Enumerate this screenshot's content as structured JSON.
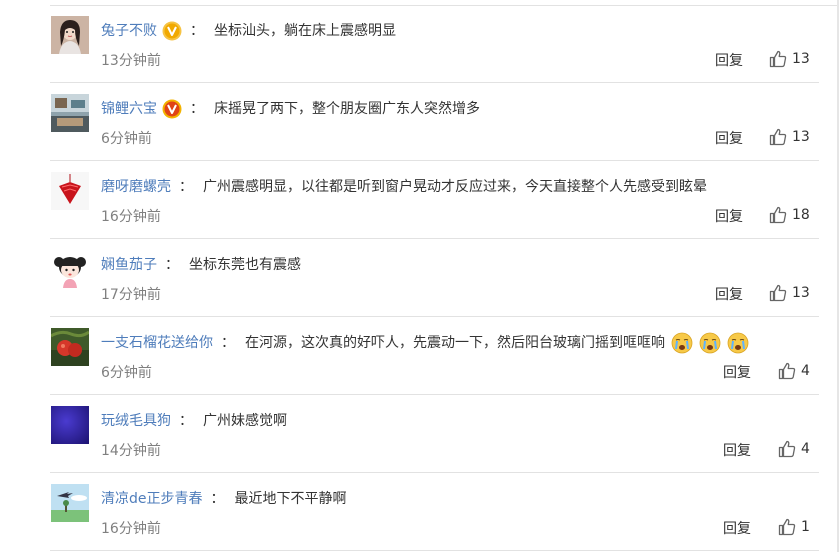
{
  "comments": [
    {
      "user": "兔子不败",
      "verified": true,
      "badge_color": "#f4b400",
      "separator": "：",
      "text": "坐标汕头，躺在床上震感明显",
      "time": "13分钟前",
      "reply_label": "回复",
      "likes": "13",
      "avatar_icon": "avatar-girl-icon"
    },
    {
      "user": "锦鲤六宝",
      "verified": true,
      "badge_color": "#e8a000",
      "separator": "：",
      "text": "床摇晃了两下，整个朋友圈广东人突然增多",
      "time": "6分钟前",
      "reply_label": "回复",
      "likes": "13",
      "avatar_icon": "avatar-room-icon"
    },
    {
      "user": "磨呀磨螺壳",
      "verified": false,
      "separator": "：",
      "text": "广州震感明显，以往都是听到窗户晃动才反应过来，今天直接整个人先感受到眩晕",
      "time": "16分钟前",
      "reply_label": "回复",
      "likes": "18",
      "avatar_icon": "avatar-red-ornament-icon"
    },
    {
      "user": "娴鱼茄子",
      "verified": false,
      "separator": "：",
      "text": "坐标东莞也有震感",
      "time": "17分钟前",
      "reply_label": "回复",
      "likes": "13",
      "avatar_icon": "avatar-cartoon-girl-icon"
    },
    {
      "user": "一支石榴花送给你",
      "verified": false,
      "separator": "：",
      "text": "在河源，这次真的好吓人，先震动一下，然后阳台玻璃门摇到哐哐响",
      "emojis": [
        "crying-emoji",
        "crying-emoji",
        "crying-emoji"
      ],
      "time": "6分钟前",
      "reply_label": "回复",
      "likes": "4",
      "avatar_icon": "avatar-pomegranate-icon"
    },
    {
      "user": "玩绒毛具狗",
      "verified": false,
      "separator": "：",
      "text": "广州妹感觉啊",
      "time": "14分钟前",
      "reply_label": "回复",
      "likes": "4",
      "avatar_icon": "avatar-purple-icon"
    },
    {
      "user": "清凉de正步青春",
      "verified": false,
      "separator": "：",
      "text": "最近地下不平静啊",
      "time": "16分钟前",
      "reply_label": "回复",
      "likes": "1",
      "avatar_icon": "avatar-sky-plane-icon"
    }
  ],
  "colors": {
    "username": "#4f7dbb",
    "time": "#808080",
    "text": "#333333",
    "divider": "#e2e2e2"
  }
}
